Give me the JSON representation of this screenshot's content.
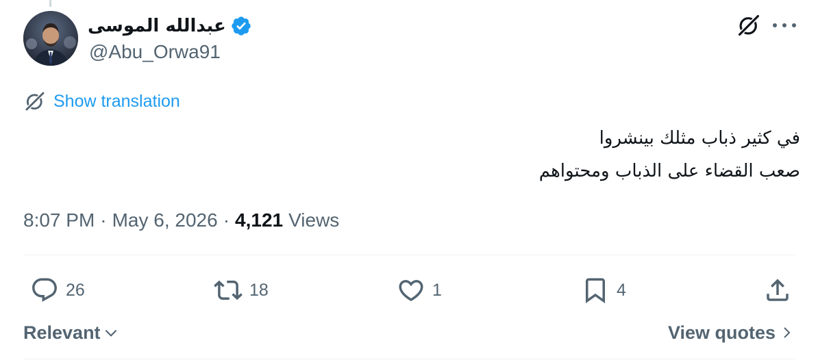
{
  "colors": {
    "accent": "#1d9bf0",
    "text_primary": "#0f1419",
    "text_secondary": "#536471",
    "divider": "#eff3f4"
  },
  "author": {
    "display_name": "عبدالله الموسى",
    "handle": "@Abu_Orwa91",
    "verified_icon": "verified-badge-icon"
  },
  "header": {
    "grok_icon": "grok-icon",
    "more_icon": "more-icon"
  },
  "translate": {
    "icon": "grok-icon",
    "label": "Show translation"
  },
  "tweet": {
    "lines": [
      "في كثير ذباب مثلك بينشروا",
      "صعب القضاء على الذباب ومحتواهم"
    ]
  },
  "meta": {
    "time": "8:07 PM",
    "separator": "·",
    "date": "May 6, 2026",
    "views_count": "4,121",
    "views_label": "Views"
  },
  "actions": {
    "reply": {
      "icon": "reply-icon",
      "count": "26"
    },
    "retweet": {
      "icon": "retweet-icon",
      "count": "18"
    },
    "like": {
      "icon": "heart-icon",
      "count": "1"
    },
    "bookmark": {
      "icon": "bookmark-icon",
      "count": "4"
    },
    "share": {
      "icon": "share-icon"
    }
  },
  "replies_bar": {
    "sort_label": "Relevant",
    "quotes_label": "View quotes"
  }
}
